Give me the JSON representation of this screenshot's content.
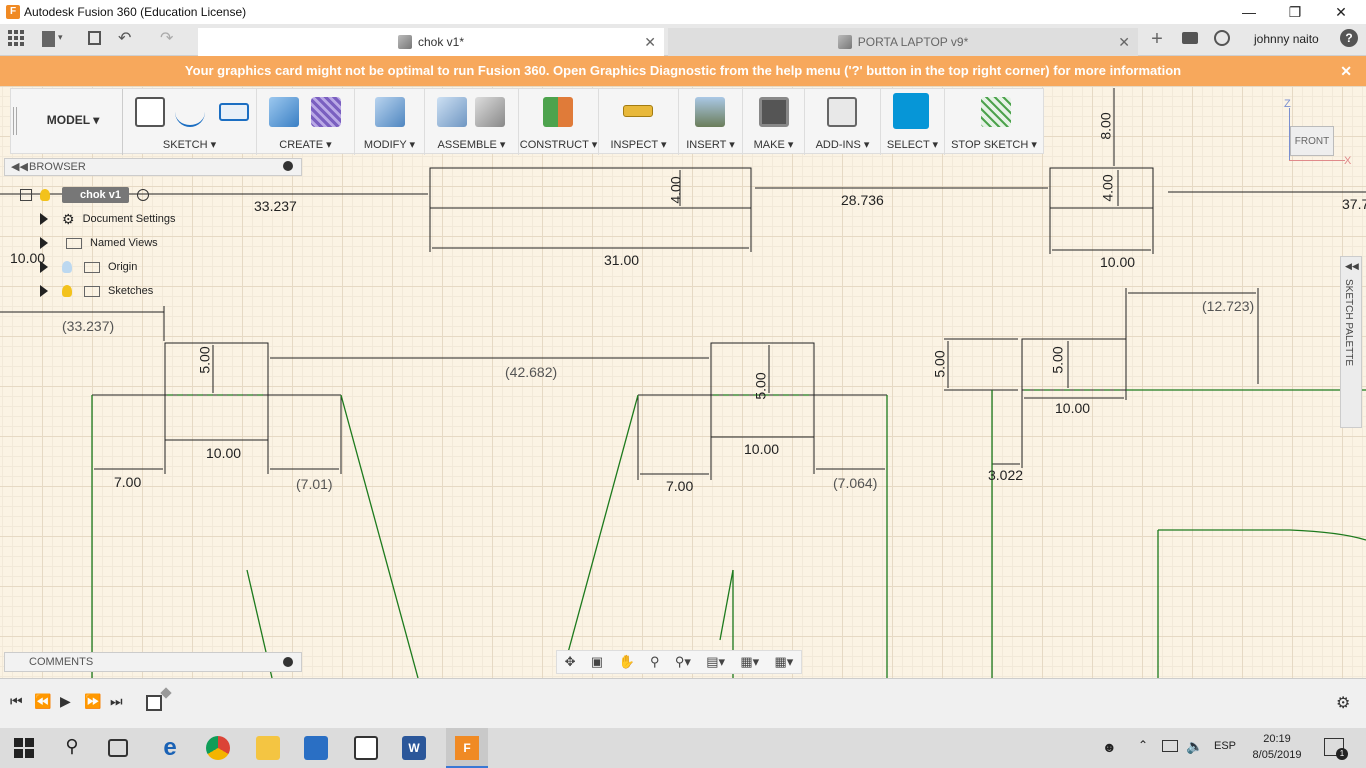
{
  "window": {
    "title": "Autodesk Fusion 360 (Education License)",
    "app_icon": "F"
  },
  "tabs": [
    {
      "label": "chok v1*",
      "active": true
    },
    {
      "label": "PORTA LAPTOP v9*",
      "active": false
    }
  ],
  "user": {
    "name": "johnny naito"
  },
  "banner": {
    "text": "Your graphics card might not be optimal to run Fusion 360. Open Graphics Diagnostic from the help menu ('?' button in the top right corner) for more information",
    "close": "✕"
  },
  "workspace": {
    "label": "MODEL"
  },
  "toolbar": {
    "groups": [
      {
        "label": "SKETCH ▾"
      },
      {
        "label": "CREATE ▾"
      },
      {
        "label": "MODIFY ▾"
      },
      {
        "label": "ASSEMBLE ▾"
      },
      {
        "label": "CONSTRUCT ▾"
      },
      {
        "label": "INSPECT ▾"
      },
      {
        "label": "INSERT ▾"
      },
      {
        "label": "MAKE ▾"
      },
      {
        "label": "ADD-INS ▾"
      },
      {
        "label": "SELECT ▾"
      },
      {
        "label": "STOP SKETCH ▾"
      }
    ]
  },
  "browser": {
    "title": "BROWSER",
    "root": "chok v1",
    "items": [
      "Document Settings",
      "Named Views",
      "Origin",
      "Sketches"
    ]
  },
  "comments": {
    "title": "COMMENTS"
  },
  "viewcube": {
    "face": "FRONT",
    "z": "Z",
    "x": "X"
  },
  "palette": {
    "label": "SKETCH PALETTE"
  },
  "dimensions": {
    "d1": "33.237",
    "d2": "31.00",
    "d3": "4.00",
    "d4": "28.736",
    "d5": "8.00",
    "d6": "4.00",
    "d7": "10.00",
    "d8": "37.7",
    "d9": "10.00",
    "d10": "(33.237)",
    "d11": "5.00",
    "d12": "(42.682)",
    "d13": "5.00",
    "d14": "10.00",
    "d15": "7.00",
    "d16": "(7.01)",
    "d17": "10.00",
    "d18": "7.00",
    "d19": "(7.064)",
    "d20": "(12.723)",
    "d21": "5.00",
    "d22": "5.00",
    "d23": "10.00",
    "d24": "3.022"
  },
  "taskbar": {
    "time": "20:19",
    "date": "8/05/2019",
    "lang": "ESP",
    "notif": "1"
  },
  "colors": {
    "banner": "#f7a85c",
    "accent": "#0696d7",
    "sketch_green": "#1d7a1d"
  }
}
